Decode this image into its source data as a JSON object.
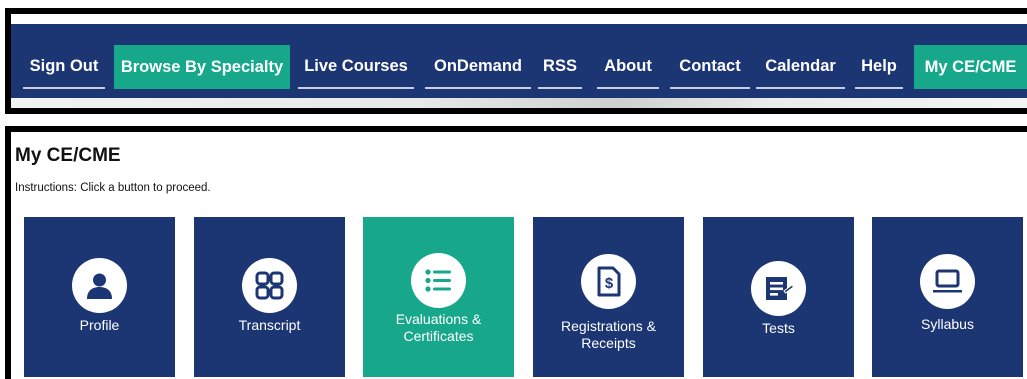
{
  "nav": {
    "items": [
      {
        "label": "Sign Out"
      },
      {
        "label": "Browse By Specialty"
      },
      {
        "label": "Live Courses"
      },
      {
        "label": "OnDemand"
      },
      {
        "label": "RSS"
      },
      {
        "label": "About"
      },
      {
        "label": "Contact"
      },
      {
        "label": "Calendar"
      },
      {
        "label": "Help"
      },
      {
        "label": "My CE/CME"
      }
    ],
    "active_items": [
      "Browse By Specialty",
      "My CE/CME"
    ]
  },
  "page": {
    "title": "My CE/CME",
    "instructions": "Instructions: Click a button to proceed."
  },
  "tiles": [
    {
      "label": "Profile",
      "icon": "user-icon"
    },
    {
      "label": "Transcript",
      "icon": "grid-icon"
    },
    {
      "label": "Evaluations & Certificates",
      "icon": "list-icon"
    },
    {
      "label": "Registrations & Receipts",
      "icon": "receipt-icon"
    },
    {
      "label": "Tests",
      "icon": "test-icon"
    },
    {
      "label": "Syllabus",
      "icon": "laptop-icon"
    }
  ],
  "colors": {
    "navy": "#1c3573",
    "teal": "#17a88c",
    "frame": "#000000"
  }
}
